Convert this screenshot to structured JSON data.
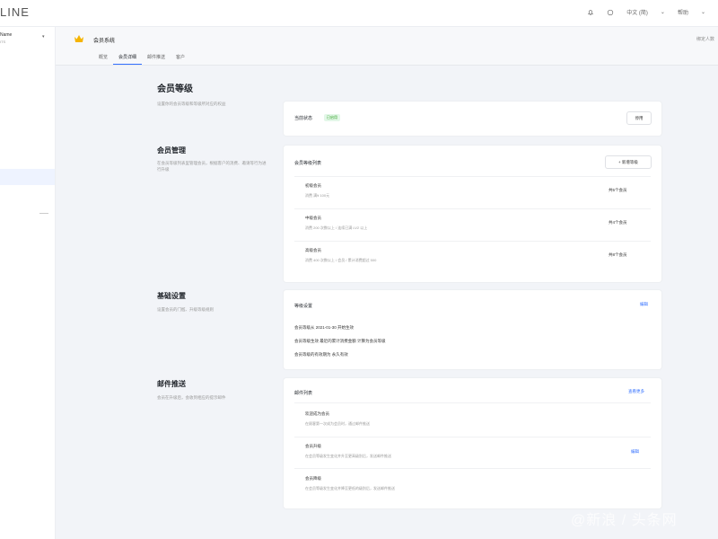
{
  "app": {
    "logo": "LINE"
  },
  "topbar": {
    "lang": "中文 (简)",
    "user": "帮助"
  },
  "sidebar": {
    "team_name": "Name",
    "team_sub": "ITS"
  },
  "header": {
    "app_title": "会员系统",
    "right_text": "绑定人数"
  },
  "tabs": [
    {
      "label": "概览"
    },
    {
      "label": "会员详细"
    },
    {
      "label": "邮件推送"
    },
    {
      "label": "客户"
    }
  ],
  "page": {
    "title": "会员等级",
    "desc": "设置你的会员等级和等级所对应的权益"
  },
  "sections": {
    "status": {
      "label": "当前状态",
      "badge": "已启用",
      "button": "停用"
    },
    "mgmt": {
      "title": "会员管理",
      "desc": "在会员等级列表里管理会员，根据客户的消费、邀请等行为进行升级",
      "card_title": "会员等级列表",
      "add_button": "+ 新增等级",
      "levels": [
        {
          "name": "初级会员",
          "desc": "消费 满¥ 100元",
          "action": "共5个会员"
        },
        {
          "name": "中级会员",
          "desc": "消费 200 次数以上 / 连续已满 LV2 以上",
          "action": "共4个会员"
        },
        {
          "name": "高级会员",
          "desc": "消费 400 次数以上 / 会员 / 累计消费超过 500",
          "action": "共8个会员"
        }
      ]
    },
    "basic": {
      "title": "基础设置",
      "desc": "设置会员的门槛、升级等级规则",
      "card_title": "等级设置",
      "edit": "编辑",
      "lines": [
        "会员等级从 2021-01-30 开始生效",
        "会员等级生效 最近的累计消费金额 计算为会员等级",
        "会员等级的有效期为 永久有效"
      ]
    },
    "mail": {
      "title": "邮件推送",
      "desc": "会员在升级后，会收到相应的提示邮件",
      "card_title": "邮件列表",
      "more": "查看更多",
      "edit": "编辑",
      "items": [
        {
          "name": "欢迎成为会员",
          "desc": "在顾客第一次成为会员时，通过邮件推送"
        },
        {
          "name": "会员升级",
          "desc": "在会员等级发生变化并升至更高级别后，发送邮件推送"
        },
        {
          "name": "会员降级",
          "desc": "在会员等级发生变化并降至更低的级别后，发送邮件推送"
        }
      ]
    }
  },
  "watermark": "@新浪 / 头条网",
  "colors": {
    "accent": "#3370ff",
    "success": "#2ea121",
    "bg": "#f2f4f8"
  }
}
